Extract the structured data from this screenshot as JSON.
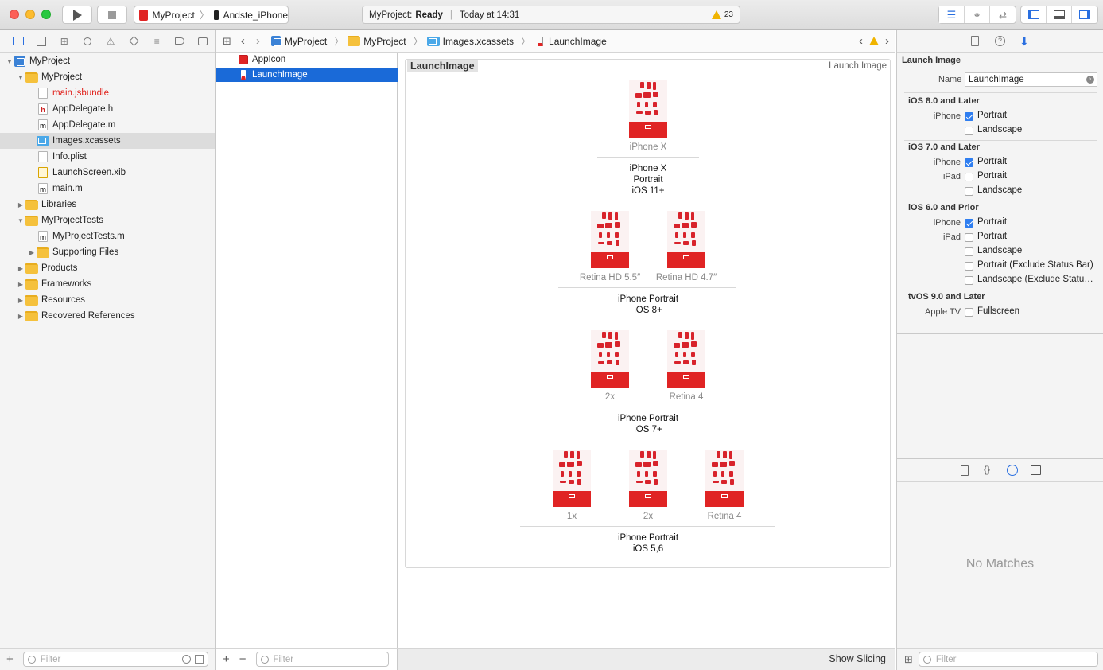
{
  "toolbar": {
    "scheme_project": "MyProject",
    "scheme_device": "Andste_iPhone",
    "status_project": "MyProject:",
    "status_state": "Ready",
    "status_time": "Today at 14:31",
    "warning_count": "23"
  },
  "navigator": {
    "items": [
      {
        "label": "MyProject",
        "type": "project"
      },
      {
        "label": "MyProject",
        "type": "folder"
      },
      {
        "label": "main.jsbundle",
        "type": "file",
        "missing": true
      },
      {
        "label": "AppDelegate.h",
        "type": "h"
      },
      {
        "label": "AppDelegate.m",
        "type": "m"
      },
      {
        "label": "Images.xcassets",
        "type": "xcassets"
      },
      {
        "label": "Info.plist",
        "type": "plist"
      },
      {
        "label": "LaunchScreen.xib",
        "type": "xib"
      },
      {
        "label": "main.m",
        "type": "m"
      },
      {
        "label": "Libraries",
        "type": "folder"
      },
      {
        "label": "MyProjectTests",
        "type": "folder"
      },
      {
        "label": "MyProjectTests.m",
        "type": "m"
      },
      {
        "label": "Supporting Files",
        "type": "folder"
      },
      {
        "label": "Products",
        "type": "folder"
      },
      {
        "label": "Frameworks",
        "type": "folder"
      },
      {
        "label": "Resources",
        "type": "folder"
      },
      {
        "label": "Recovered References",
        "type": "folder"
      }
    ],
    "filter_placeholder": "Filter"
  },
  "jumpbar": {
    "crumbs": [
      "MyProject",
      "MyProject",
      "Images.xcassets",
      "LaunchImage"
    ]
  },
  "assets": {
    "items": [
      "AppIcon",
      "LaunchImage"
    ],
    "filter_placeholder": "Filter"
  },
  "editor": {
    "set_name": "LaunchImage",
    "set_type": "Launch Image",
    "groups": [
      {
        "slots": [
          "iPhone X"
        ],
        "label_lines": [
          "iPhone X",
          "Portrait",
          "iOS 11+"
        ]
      },
      {
        "slots": [
          "Retina HD 5.5″",
          "Retina HD 4.7″"
        ],
        "label_lines": [
          "iPhone Portrait",
          "iOS 8+"
        ]
      },
      {
        "slots": [
          "2x",
          "Retina 4"
        ],
        "label_lines": [
          "iPhone Portrait",
          "iOS 7+"
        ]
      },
      {
        "slots": [
          "1x",
          "2x",
          "Retina 4"
        ],
        "label_lines": [
          "iPhone Portrait",
          "iOS 5,6"
        ]
      }
    ],
    "show_slicing": "Show Slicing"
  },
  "inspector": {
    "title": "Launch Image",
    "name_label": "Name",
    "name_value": "LaunchImage",
    "sections": [
      {
        "title": "iOS 8.0 and Later",
        "rows": [
          {
            "device": "iPhone",
            "option": "Portrait",
            "checked": true
          },
          {
            "device": "",
            "option": "Landscape",
            "checked": false
          }
        ]
      },
      {
        "title": "iOS 7.0 and Later",
        "rows": [
          {
            "device": "iPhone",
            "option": "Portrait",
            "checked": true
          },
          {
            "device": "iPad",
            "option": "Portrait",
            "checked": false
          },
          {
            "device": "",
            "option": "Landscape",
            "checked": false
          }
        ]
      },
      {
        "title": "iOS 6.0 and Prior",
        "rows": [
          {
            "device": "iPhone",
            "option": "Portrait",
            "checked": true
          },
          {
            "device": "iPad",
            "option": "Portrait",
            "checked": false
          },
          {
            "device": "",
            "option": "Landscape",
            "checked": false
          },
          {
            "device": "",
            "option": "Portrait (Exclude Status Bar)",
            "checked": false
          },
          {
            "device": "",
            "option": "Landscape (Exclude Status…",
            "checked": false
          }
        ]
      },
      {
        "title": "tvOS 9.0 and Later",
        "rows": [
          {
            "device": "Apple TV",
            "option": "Fullscreen",
            "checked": false
          }
        ]
      }
    ],
    "library_empty": "No Matches",
    "filter_placeholder": "Filter"
  },
  "colors": {
    "selection": "#1a6ad8",
    "accent": "#2f7ef0",
    "launch_red": "#e02424",
    "warning": "#f0b400"
  }
}
